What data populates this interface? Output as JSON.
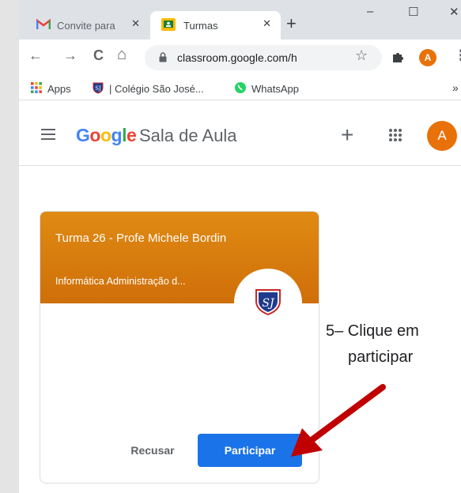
{
  "browser": {
    "tabs": [
      {
        "title": "Convite para",
        "icon": "gmail-icon",
        "active": false
      },
      {
        "title": "Turmas",
        "icon": "classroom-icon",
        "active": true
      }
    ],
    "new_tab_symbol": "+",
    "window_controls": {
      "minimize": "–",
      "maximize": "☐",
      "close": "✕"
    },
    "toolbar": {
      "back": "←",
      "forward": "→",
      "reload": "C",
      "home": "⌂",
      "url": "classroom.google.com/h",
      "bookmark_star": "☆",
      "extensions_icon": "puzzle-icon",
      "profile_initial": "A",
      "menu": "⋮"
    },
    "bookmarks": {
      "items": [
        {
          "label": "Apps",
          "icon": "apps-grid-icon"
        },
        {
          "label": "| Colégio São José...",
          "icon": "school-crest-icon"
        },
        {
          "label": "WhatsApp",
          "icon": "whatsapp-icon"
        }
      ],
      "overflow": "»"
    }
  },
  "app": {
    "brand_google": [
      "G",
      "o",
      "o",
      "g",
      "l",
      "e"
    ],
    "brand_google_colors": [
      "#4285f4",
      "#ea4335",
      "#fbbc05",
      "#4285f4",
      "#34a853",
      "#ea4335"
    ],
    "brand_rest": "Sala de Aula",
    "add_button": "+",
    "avatar_initial": "A",
    "accent_color": "#1a73e8",
    "avatar_color": "#e8710a"
  },
  "card": {
    "title": "Turma 26 - Profe Michele Bordin",
    "subtitle": "Informática Administração d...",
    "crest_icon": "school-crest-icon",
    "header_color": "#d97b0e",
    "decline_label": "Recusar",
    "join_label": "Participar"
  },
  "annotation": {
    "line1": "5– Clique em",
    "line2": "participar",
    "arrow_color": "#c00000"
  }
}
